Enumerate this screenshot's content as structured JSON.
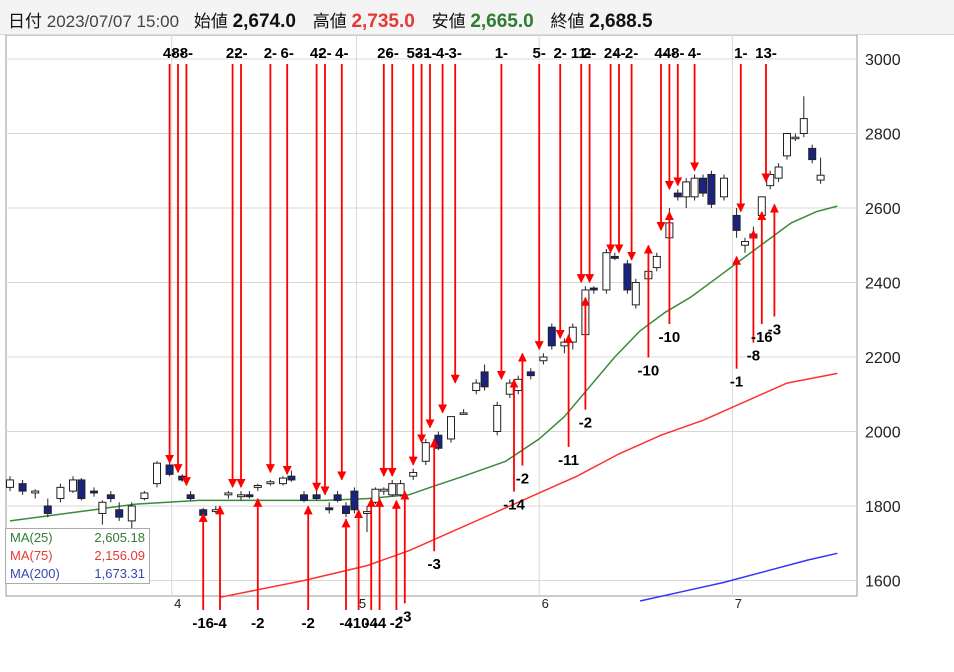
{
  "header": {
    "date_label": "日付",
    "date_value": "2023/07/07 15:00",
    "open_label": "始値",
    "open_value": "2,674.0",
    "high_label": "高値",
    "high_value": "2,735.0",
    "low_label": "安値",
    "low_value": "2,665.0",
    "close_label": "終値",
    "close_value": "2,688.5"
  },
  "legend": [
    {
      "name": "MA(25)",
      "value": "2,605.18",
      "color": "#2e7d32"
    },
    {
      "name": "MA(75)",
      "value": "2,156.09",
      "color": "#e53935"
    },
    {
      "name": "MA(200)",
      "value": "1,673.31",
      "color": "#3949ab"
    }
  ],
  "chart_data": {
    "type": "candlestick",
    "y_ticks": [
      "3000",
      "2800",
      "2600",
      "2400",
      "2200",
      "2000",
      "1800",
      "1600"
    ],
    "y_tick_values": [
      3000,
      2800,
      2600,
      2400,
      2200,
      2000,
      1800,
      1600
    ],
    "ylim": [
      1545,
      3075
    ],
    "x_ticks": [
      "4",
      "5",
      "6",
      "7"
    ],
    "x_tick_index": [
      38.5,
      82.5,
      126,
      172
    ],
    "n_bars": 183,
    "grid": true,
    "colors": {
      "up": "#ffffff",
      "down": "#1a237e",
      "arrow": "#ff0000",
      "ma25": "#3a8a3a",
      "ma75": "#ff3030",
      "ma200": "#3333ff"
    },
    "candles": [
      {
        "i": 0,
        "o": 1850,
        "h": 1880,
        "l": 1840,
        "c": 1870
      },
      {
        "i": 3,
        "o": 1860,
        "h": 1870,
        "l": 1830,
        "c": 1840
      },
      {
        "i": 6,
        "o": 1835,
        "h": 1845,
        "l": 1820,
        "c": 1840
      },
      {
        "i": 9,
        "o": 1800,
        "h": 1820,
        "l": 1770,
        "c": 1780
      },
      {
        "i": 12,
        "o": 1820,
        "h": 1860,
        "l": 1810,
        "c": 1850
      },
      {
        "i": 15,
        "o": 1840,
        "h": 1880,
        "l": 1835,
        "c": 1870
      },
      {
        "i": 17,
        "o": 1870,
        "h": 1875,
        "l": 1815,
        "c": 1820
      },
      {
        "i": 20,
        "o": 1840,
        "h": 1850,
        "l": 1825,
        "c": 1835
      },
      {
        "i": 22,
        "o": 1780,
        "h": 1815,
        "l": 1750,
        "c": 1810
      },
      {
        "i": 24,
        "o": 1830,
        "h": 1840,
        "l": 1810,
        "c": 1820
      },
      {
        "i": 26,
        "o": 1790,
        "h": 1810,
        "l": 1760,
        "c": 1770
      },
      {
        "i": 29,
        "o": 1760,
        "h": 1810,
        "l": 1740,
        "c": 1800
      },
      {
        "i": 32,
        "o": 1820,
        "h": 1840,
        "l": 1815,
        "c": 1835
      },
      {
        "i": 35,
        "o": 1860,
        "h": 1920,
        "l": 1850,
        "c": 1915
      },
      {
        "i": 38,
        "o": 1910,
        "h": 1925,
        "l": 1880,
        "c": 1885
      },
      {
        "i": 41,
        "o": 1880,
        "h": 1885,
        "l": 1865,
        "c": 1870
      },
      {
        "i": 43,
        "o": 1830,
        "h": 1840,
        "l": 1815,
        "c": 1820
      },
      {
        "i": 46,
        "o": 1790,
        "h": 1795,
        "l": 1770,
        "c": 1775
      },
      {
        "i": 49,
        "o": 1785,
        "h": 1800,
        "l": 1780,
        "c": 1790
      },
      {
        "i": 52,
        "o": 1830,
        "h": 1840,
        "l": 1820,
        "c": 1835
      },
      {
        "i": 55,
        "o": 1825,
        "h": 1840,
        "l": 1815,
        "c": 1830
      },
      {
        "i": 57,
        "o": 1830,
        "h": 1840,
        "l": 1820,
        "c": 1825
      },
      {
        "i": 59,
        "o": 1850,
        "h": 1860,
        "l": 1840,
        "c": 1855
      },
      {
        "i": 62,
        "o": 1860,
        "h": 1870,
        "l": 1855,
        "c": 1865
      },
      {
        "i": 65,
        "o": 1860,
        "h": 1880,
        "l": 1855,
        "c": 1875
      },
      {
        "i": 67,
        "o": 1880,
        "h": 1895,
        "l": 1865,
        "c": 1870
      },
      {
        "i": 70,
        "o": 1830,
        "h": 1840,
        "l": 1810,
        "c": 1815
      },
      {
        "i": 73,
        "o": 1830,
        "h": 1840,
        "l": 1815,
        "c": 1820
      },
      {
        "i": 76,
        "o": 1795,
        "h": 1810,
        "l": 1780,
        "c": 1790
      },
      {
        "i": 78,
        "o": 1830,
        "h": 1840,
        "l": 1810,
        "c": 1815
      },
      {
        "i": 80,
        "o": 1800,
        "h": 1810,
        "l": 1770,
        "c": 1780
      },
      {
        "i": 82,
        "o": 1840,
        "h": 1850,
        "l": 1780,
        "c": 1790
      },
      {
        "i": 85,
        "o": 1780,
        "h": 1800,
        "l": 1730,
        "c": 1785
      },
      {
        "i": 87,
        "o": 1810,
        "h": 1850,
        "l": 1805,
        "c": 1845
      },
      {
        "i": 89,
        "o": 1840,
        "h": 1850,
        "l": 1830,
        "c": 1845
      },
      {
        "i": 91,
        "o": 1830,
        "h": 1870,
        "l": 1825,
        "c": 1860
      },
      {
        "i": 93,
        "o": 1830,
        "h": 1870,
        "l": 1825,
        "c": 1860
      },
      {
        "i": 96,
        "o": 1880,
        "h": 1900,
        "l": 1870,
        "c": 1890
      },
      {
        "i": 99,
        "o": 1920,
        "h": 1980,
        "l": 1910,
        "c": 1970
      },
      {
        "i": 102,
        "o": 1990,
        "h": 2000,
        "l": 1950,
        "c": 1955
      },
      {
        "i": 105,
        "o": 1980,
        "h": 2040,
        "l": 1970,
        "c": 2040
      },
      {
        "i": 108,
        "o": 2050,
        "h": 2060,
        "l": 2045,
        "c": 2050
      },
      {
        "i": 111,
        "o": 2110,
        "h": 2140,
        "l": 2100,
        "c": 2130
      },
      {
        "i": 113,
        "o": 2160,
        "h": 2180,
        "l": 2110,
        "c": 2120
      },
      {
        "i": 116,
        "o": 2000,
        "h": 2080,
        "l": 1990,
        "c": 2070
      },
      {
        "i": 119,
        "o": 2100,
        "h": 2140,
        "l": 2090,
        "c": 2130
      },
      {
        "i": 121,
        "o": 2110,
        "h": 2150,
        "l": 2100,
        "c": 2140
      },
      {
        "i": 124,
        "o": 2160,
        "h": 2170,
        "l": 2140,
        "c": 2150
      },
      {
        "i": 127,
        "o": 2190,
        "h": 2210,
        "l": 2180,
        "c": 2200
      },
      {
        "i": 129,
        "o": 2280,
        "h": 2290,
        "l": 2220,
        "c": 2230
      },
      {
        "i": 132,
        "o": 2230,
        "h": 2250,
        "l": 2210,
        "c": 2240
      },
      {
        "i": 134,
        "o": 2240,
        "h": 2290,
        "l": 2220,
        "c": 2280
      },
      {
        "i": 137,
        "o": 2260,
        "h": 2390,
        "l": 2250,
        "c": 2380
      },
      {
        "i": 139,
        "o": 2385,
        "h": 2390,
        "l": 2370,
        "c": 2380
      },
      {
        "i": 142,
        "o": 2380,
        "h": 2490,
        "l": 2370,
        "c": 2480
      },
      {
        "i": 144,
        "o": 2470,
        "h": 2480,
        "l": 2460,
        "c": 2465
      },
      {
        "i": 147,
        "o": 2450,
        "h": 2460,
        "l": 2370,
        "c": 2380
      },
      {
        "i": 149,
        "o": 2340,
        "h": 2410,
        "l": 2330,
        "c": 2400
      },
      {
        "i": 152,
        "o": 2410,
        "h": 2440,
        "l": 2400,
        "c": 2430
      },
      {
        "i": 154,
        "o": 2440,
        "h": 2480,
        "l": 2430,
        "c": 2470
      },
      {
        "i": 157,
        "o": 2520,
        "h": 2600,
        "l": 2510,
        "c": 2560
      },
      {
        "i": 159,
        "o": 2640,
        "h": 2650,
        "l": 2620,
        "c": 2630
      },
      {
        "i": 161,
        "o": 2630,
        "h": 2680,
        "l": 2600,
        "c": 2670
      },
      {
        "i": 163,
        "o": 2630,
        "h": 2690,
        "l": 2620,
        "c": 2680
      },
      {
        "i": 165,
        "o": 2680,
        "h": 2690,
        "l": 2630,
        "c": 2640
      },
      {
        "i": 167,
        "o": 2690,
        "h": 2700,
        "l": 2600,
        "c": 2610
      },
      {
        "i": 170,
        "o": 2630,
        "h": 2690,
        "l": 2620,
        "c": 2680
      },
      {
        "i": 173,
        "o": 2580,
        "h": 2600,
        "l": 2520,
        "c": 2540
      },
      {
        "i": 175,
        "o": 2500,
        "h": 2520,
        "l": 2480,
        "c": 2510
      },
      {
        "i": 177,
        "o": 2520,
        "h": 2550,
        "l": 2500,
        "c": 2530
      },
      {
        "i": 179,
        "o": 2580,
        "h": 2630,
        "l": 2570,
        "c": 2630
      },
      {
        "i": 181,
        "o": 2660,
        "h": 2700,
        "l": 2650,
        "c": 2690
      },
      {
        "i": 183,
        "o": 2680,
        "h": 2720,
        "l": 2670,
        "c": 2710
      },
      {
        "i": 185,
        "o": 2740,
        "h": 2800,
        "l": 2730,
        "c": 2800
      },
      {
        "i": 187,
        "o": 2790,
        "h": 2800,
        "l": 2780,
        "c": 2790
      },
      {
        "i": 189,
        "o": 2800,
        "h": 2900,
        "l": 2790,
        "c": 2840
      },
      {
        "i": 191,
        "o": 2760,
        "h": 2770,
        "l": 2720,
        "c": 2730
      },
      {
        "i": 193,
        "o": 2675,
        "h": 2735,
        "l": 2665,
        "c": 2688
      }
    ],
    "ma25": [
      [
        0,
        1760
      ],
      [
        20,
        1790
      ],
      [
        30,
        1805
      ],
      [
        45,
        1815
      ],
      [
        60,
        1815
      ],
      [
        75,
        1815
      ],
      [
        85,
        1820
      ],
      [
        95,
        1830
      ],
      [
        100,
        1850
      ],
      [
        108,
        1880
      ],
      [
        118,
        1920
      ],
      [
        126,
        1980
      ],
      [
        132,
        2040
      ],
      [
        138,
        2120
      ],
      [
        144,
        2200
      ],
      [
        150,
        2270
      ],
      [
        156,
        2320
      ],
      [
        162,
        2360
      ],
      [
        168,
        2410
      ],
      [
        174,
        2460
      ],
      [
        180,
        2510
      ],
      [
        186,
        2560
      ],
      [
        192,
        2590
      ],
      [
        197,
        2605
      ]
    ],
    "ma75": [
      [
        50,
        1555
      ],
      [
        70,
        1600
      ],
      [
        85,
        1640
      ],
      [
        95,
        1680
      ],
      [
        105,
        1730
      ],
      [
        115,
        1780
      ],
      [
        125,
        1830
      ],
      [
        135,
        1880
      ],
      [
        145,
        1940
      ],
      [
        155,
        1990
      ],
      [
        165,
        2030
      ],
      [
        175,
        2080
      ],
      [
        185,
        2130
      ],
      [
        197,
        2156
      ]
    ],
    "ma200": [
      [
        150,
        1545
      ],
      [
        160,
        1570
      ],
      [
        170,
        1595
      ],
      [
        180,
        1625
      ],
      [
        190,
        1655
      ],
      [
        197,
        1673
      ]
    ],
    "signals_down": [
      {
        "i": 38,
        "label": "4-",
        "target": 1905
      },
      {
        "i": 40,
        "label": "8-",
        "target": 1880
      },
      {
        "i": 42,
        "label": "8-",
        "target": 1845
      },
      {
        "i": 53,
        "label": "2-",
        "target": 1840
      },
      {
        "i": 55,
        "label": "2-",
        "target": 1840
      },
      {
        "i": 62,
        "label": "2-",
        "target": 1880
      },
      {
        "i": 66,
        "label": "6-",
        "target": 1875
      },
      {
        "i": 73,
        "label": "4-",
        "target": 1830
      },
      {
        "i": 75,
        "label": "2-",
        "target": 1820
      },
      {
        "i": 79,
        "label": "4-",
        "target": 1860
      },
      {
        "i": 89,
        "label": "2-",
        "target": 1870
      },
      {
        "i": 91,
        "label": "6-",
        "target": 1870
      },
      {
        "i": 96,
        "label": "5-",
        "target": 1900
      },
      {
        "i": 98,
        "label": "3-",
        "target": 1960
      },
      {
        "i": 100,
        "label": "1-",
        "target": 2000
      },
      {
        "i": 103,
        "label": "4-",
        "target": 2040
      },
      {
        "i": 106,
        "label": "3-",
        "target": 2120
      },
      {
        "i": 117,
        "label": "1-",
        "target": 2130
      },
      {
        "i": 126,
        "label": "5-",
        "target": 2210
      },
      {
        "i": 131,
        "label": "2-",
        "target": 2240
      },
      {
        "i": 136,
        "label": "11-",
        "target": 2390
      },
      {
        "i": 138,
        "label": "2-",
        "target": 2390
      },
      {
        "i": 143,
        "label": "2-",
        "target": 2470
      },
      {
        "i": 145,
        "label": "4-",
        "target": 2470
      },
      {
        "i": 148,
        "label": "2-",
        "target": 2450
      },
      {
        "i": 155,
        "label": "4-",
        "target": 2530
      },
      {
        "i": 157,
        "label": "4-",
        "target": 2640
      },
      {
        "i": 159,
        "label": "8-",
        "target": 2650
      },
      {
        "i": 163,
        "label": "4-",
        "target": 2690
      },
      {
        "i": 174,
        "label": "1-",
        "target": 2580
      },
      {
        "i": 180,
        "label": "13-",
        "target": 2660
      }
    ],
    "signals_up": [
      {
        "i": 46,
        "label": "-16",
        "target": 1790
      },
      {
        "i": 50,
        "label": "-4",
        "target": 1810
      },
      {
        "i": 59,
        "label": "-2",
        "target": 1830
      },
      {
        "i": 71,
        "label": "-2",
        "target": 1810
      },
      {
        "i": 80,
        "label": "-4",
        "target": 1775
      },
      {
        "i": 83,
        "label": "-10",
        "target": 1800
      },
      {
        "i": 86,
        "label": "-4",
        "target": 1830
      },
      {
        "i": 88,
        "label": "-4",
        "target": 1830
      },
      {
        "i": 92,
        "label": "-2",
        "target": 1825
      },
      {
        "i": 94,
        "label": "-3",
        "target": 1850
      },
      {
        "i": 101,
        "label": "-3",
        "target": 1990
      },
      {
        "i": 120,
        "label": "-14",
        "target": 2150
      },
      {
        "i": 122,
        "label": "-2",
        "target": 2220
      },
      {
        "i": 133,
        "label": "-11",
        "target": 2270
      },
      {
        "i": 137,
        "label": "-2",
        "target": 2370
      },
      {
        "i": 152,
        "label": "-10",
        "target": 2510
      },
      {
        "i": 157,
        "label": "-10",
        "target": 2600
      },
      {
        "i": 173,
        "label": "-1",
        "target": 2480
      },
      {
        "i": 177,
        "label": "-8",
        "target": 2550
      },
      {
        "i": 179,
        "label": "-16",
        "target": 2600
      },
      {
        "i": 182,
        "label": "-3",
        "target": 2620
      }
    ]
  }
}
